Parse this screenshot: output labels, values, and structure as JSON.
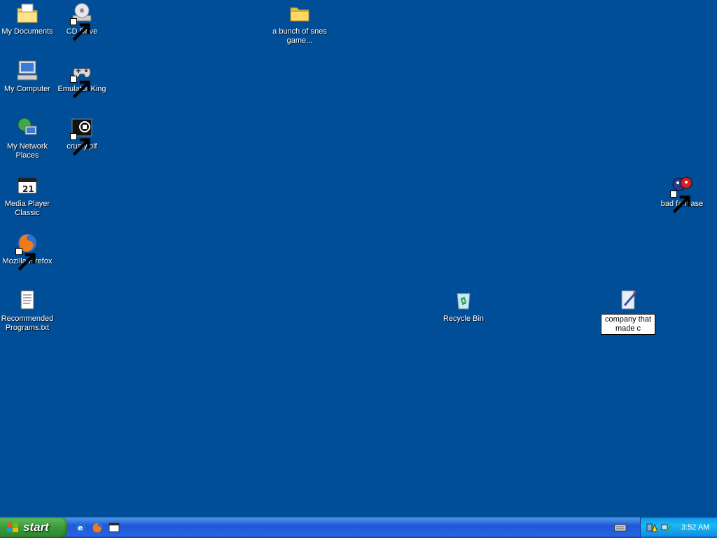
{
  "desktop": {
    "icons": [
      {
        "label": "My Documents",
        "icon": "my-documents-icon"
      },
      {
        "label": "CD Drive",
        "icon": "cd-drive-icon"
      },
      {
        "label": "a bunch of snes game...",
        "icon": "folder-icon"
      },
      {
        "label": "My Computer",
        "icon": "my-computer-icon"
      },
      {
        "label": "Emulator King",
        "icon": "gamepad-icon"
      },
      {
        "label": "My Network Places",
        "icon": "network-places-icon"
      },
      {
        "label": "crusty.pif",
        "icon": "pif-file-icon"
      },
      {
        "label": "Media Player Classic",
        "icon": "media-player-icon"
      },
      {
        "label": "bad fanbase",
        "icon": "fanbase-icon"
      },
      {
        "label": "Mozilla Firefox",
        "icon": "firefox-icon"
      },
      {
        "label": "Recommended Programs.txt",
        "icon": "text-file-icon"
      },
      {
        "label": "Recycle Bin",
        "icon": "recycle-bin-icon"
      }
    ],
    "rename_item": {
      "icon": "document-icon",
      "value": "company that made c"
    }
  },
  "taskbar": {
    "start_label": "start",
    "quick_launch": [
      "internet-explorer-icon",
      "firefox-icon",
      "media-player-icon"
    ],
    "tray_icons": [
      "keyboard-icon",
      "security-alert-icon",
      "network-icon"
    ],
    "clock": "3:52 AM"
  },
  "colors": {
    "desktop_bg": "#004e98",
    "taskbar_blue": "#245edb",
    "start_green": "#3a9a3a",
    "tray_blue": "#1290e6"
  }
}
